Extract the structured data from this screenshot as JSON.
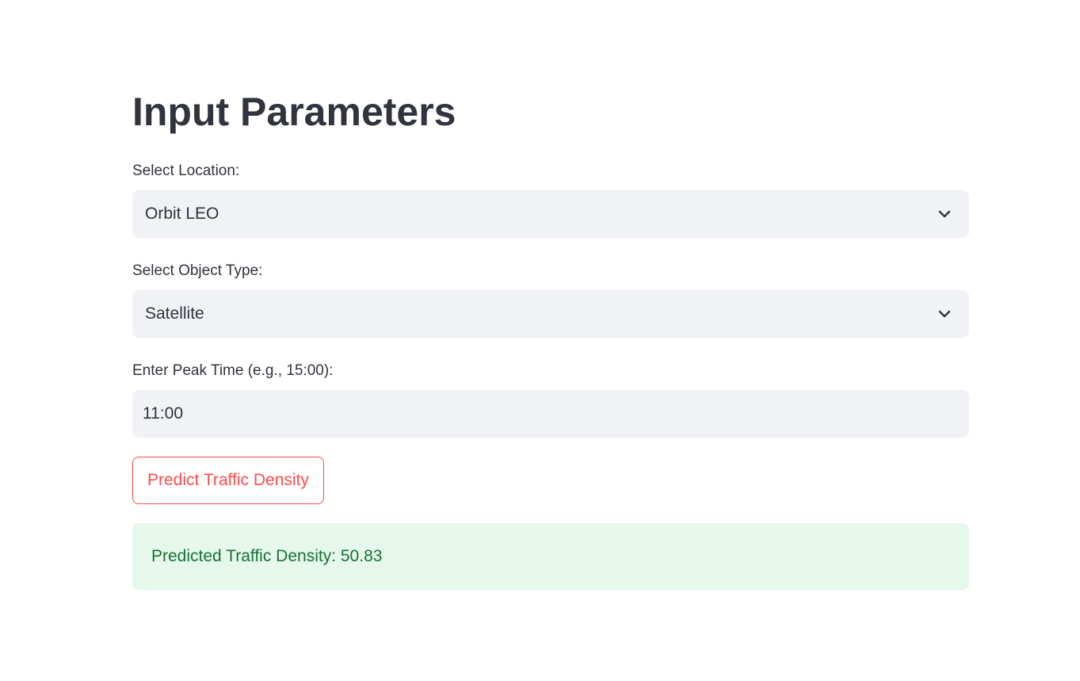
{
  "page": {
    "title": "Input Parameters"
  },
  "location": {
    "label": "Select Location:",
    "selected": "Orbit LEO",
    "icon": "chevron-down-icon"
  },
  "object_type": {
    "label": "Select Object Type:",
    "selected": "Satellite",
    "icon": "chevron-down-icon"
  },
  "peak_time": {
    "label": "Enter Peak Time (e.g., 15:00):",
    "value": "11:00"
  },
  "predict_button": {
    "label": "Predict Traffic Density"
  },
  "result": {
    "text": "Predicted Traffic Density: 50.83"
  },
  "colors": {
    "text": "#31333f",
    "input_bg": "#f0f2f6",
    "accent": "#ff4b4b",
    "success_bg": "#e6f7ec",
    "success_text": "#177233"
  }
}
